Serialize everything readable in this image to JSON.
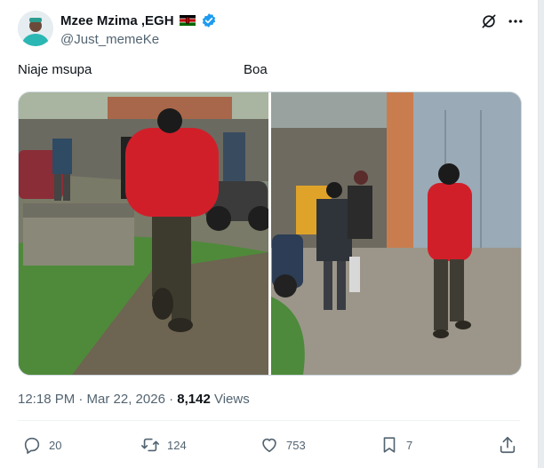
{
  "author": {
    "display_name": "Mzee Mzima ,EGH",
    "handle": "@Just_memeKe",
    "flag_icon": "kenya-flag-icon",
    "verified_icon": "verified-badge-icon",
    "verified_color": "#1d9bf0"
  },
  "tweet": {
    "caption_left": "Niaje msupa",
    "caption_right": "Boa",
    "time": "12:18 PM · Mar 22, 2026 · ",
    "views_count": "8,142",
    "views_label": " Views"
  },
  "actions": {
    "replies": "20",
    "reposts": "124",
    "likes": "753",
    "bookmarks": "7"
  },
  "colors": {
    "text": "#0f1419",
    "muted": "#536471",
    "shirt": "#d11f2a"
  }
}
